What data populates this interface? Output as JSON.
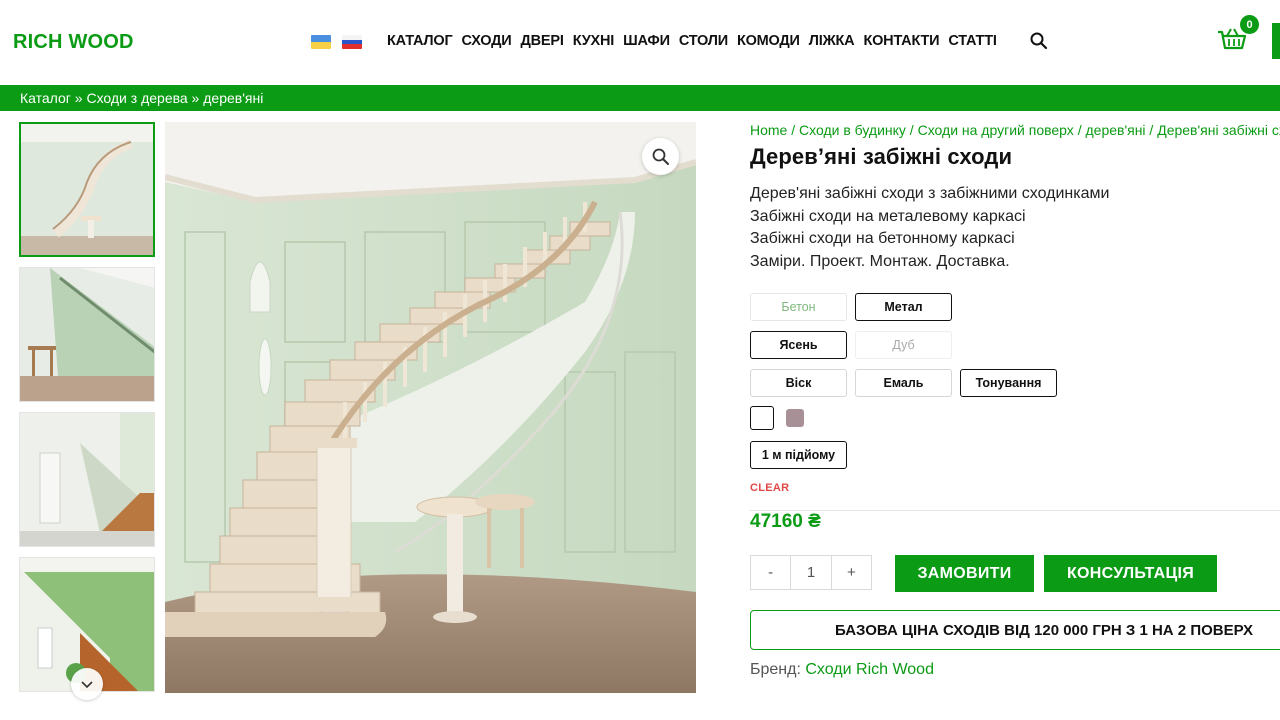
{
  "header": {
    "logo": "RICH WOOD",
    "nav": [
      "КАТАЛОГ",
      "СХОДИ",
      "ДВЕРІ",
      "КУХНІ",
      "ШАФИ",
      "СТОЛИ",
      "КОМОДИ",
      "ЛІЖКА",
      "КОНТАКТИ",
      "СТАТТІ"
    ],
    "cart_count": "0",
    "flags": [
      "ua-flag",
      "ru-flag"
    ]
  },
  "breadcrumb": "Каталог » Сходи з дерева » дерев'яні",
  "product": {
    "crumbs": [
      "Home",
      "Сходи в будинку",
      "Сходи на другий поверх",
      "дерев'яні",
      "Дерев'яні забіжні сходи"
    ],
    "crumb_sep": " / ",
    "title": "Дерев’яні забіжні сходи",
    "description": [
      "Дерев'яні забіжні сходи з забіжними сходинками",
      "Забіжні сходи на металевому каркасі",
      "Забіжні сходи на бетонному каркасі",
      "Заміри. Проект. Монтаж. Доставка."
    ],
    "options": {
      "frame": [
        "Бетон",
        "Метал"
      ],
      "wood": [
        "Ясень",
        "Дуб"
      ],
      "finish": [
        "Віск",
        "Емаль",
        "Тонування"
      ],
      "length": "1 м підйому"
    },
    "clear_label": "CLEAR",
    "price": "47160 ₴",
    "quantity": "1",
    "qty_minus": "-",
    "qty_plus": "+",
    "order_label": "ЗАМОВИТИ",
    "consult_label": "КОНСУЛЬТАЦІЯ",
    "base_price_note": "БАЗОВА ЦІНА СХОДІВ ВІД 120 000 ГРН З 1 НА 2 ПОВЕРХ",
    "brand_label": "Бренд:",
    "brand_value": "Сходи Rich Wood"
  },
  "colors": {
    "accent": "#0b9b14",
    "clear": "#e24848",
    "swatch_white": "#ffffff",
    "swatch_mauve": "#a89196"
  }
}
